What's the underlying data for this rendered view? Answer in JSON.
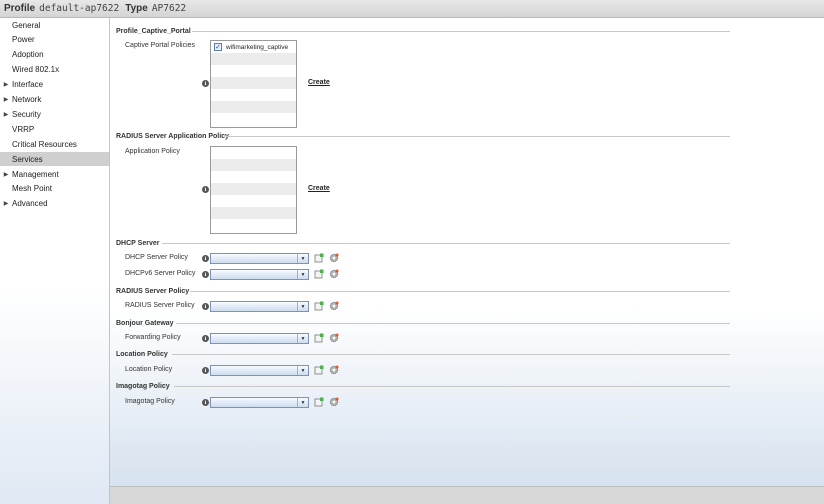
{
  "header": {
    "profile_label": "Profile",
    "profile_value": "default-ap7622",
    "type_label": "Type",
    "type_value": "AP7622"
  },
  "sidebar": {
    "items": [
      {
        "label": "General",
        "expandable": false,
        "selected": false
      },
      {
        "label": "Power",
        "expandable": false,
        "selected": false
      },
      {
        "label": "Adoption",
        "expandable": false,
        "selected": false
      },
      {
        "label": "Wired 802.1x",
        "expandable": false,
        "selected": false
      },
      {
        "label": "Interface",
        "expandable": true,
        "selected": false
      },
      {
        "label": "Network",
        "expandable": true,
        "selected": false
      },
      {
        "label": "Security",
        "expandable": true,
        "selected": false
      },
      {
        "label": "VRRP",
        "expandable": false,
        "selected": false
      },
      {
        "label": "Critical Resources",
        "expandable": false,
        "selected": false
      },
      {
        "label": "Services",
        "expandable": false,
        "selected": true
      },
      {
        "label": "Management",
        "expandable": true,
        "selected": false
      },
      {
        "label": "Mesh Point",
        "expandable": false,
        "selected": false
      },
      {
        "label": "Advanced",
        "expandable": true,
        "selected": false
      }
    ]
  },
  "captive_portal": {
    "section_title": "Profile_Captive_Portal",
    "field_label": "Captive Portal Policies",
    "items": [
      "wifimarketing_captive"
    ],
    "create_label": "Create"
  },
  "radius_app": {
    "section_title": "RADIUS Server Application Policy",
    "field_label": "Application Policy",
    "create_label": "Create"
  },
  "dhcp": {
    "section_title": "DHCP Server",
    "server_label": "DHCP Server Policy",
    "server6_label": "DHCPv6 Server Policy"
  },
  "radius_policy": {
    "section_title": "RADIUS Server Policy",
    "field_label": "RADIUS Server Policy"
  },
  "bonjour": {
    "section_title": "Bonjour Gateway",
    "field_label": "Forwarding Policy"
  },
  "location": {
    "section_title": "Location Policy",
    "field_label": "Location Policy"
  },
  "imagotag": {
    "section_title": "Imagotag Policy",
    "field_label": "Imagotag Policy"
  },
  "colors": {
    "selected_nav": "#cfcfcf",
    "combo_border": "#7e93b4",
    "checkbox_mark": "#1f4f99"
  },
  "icons": {
    "info": "info-icon",
    "new": "new-policy-icon",
    "edit": "edit-gear-icon"
  }
}
